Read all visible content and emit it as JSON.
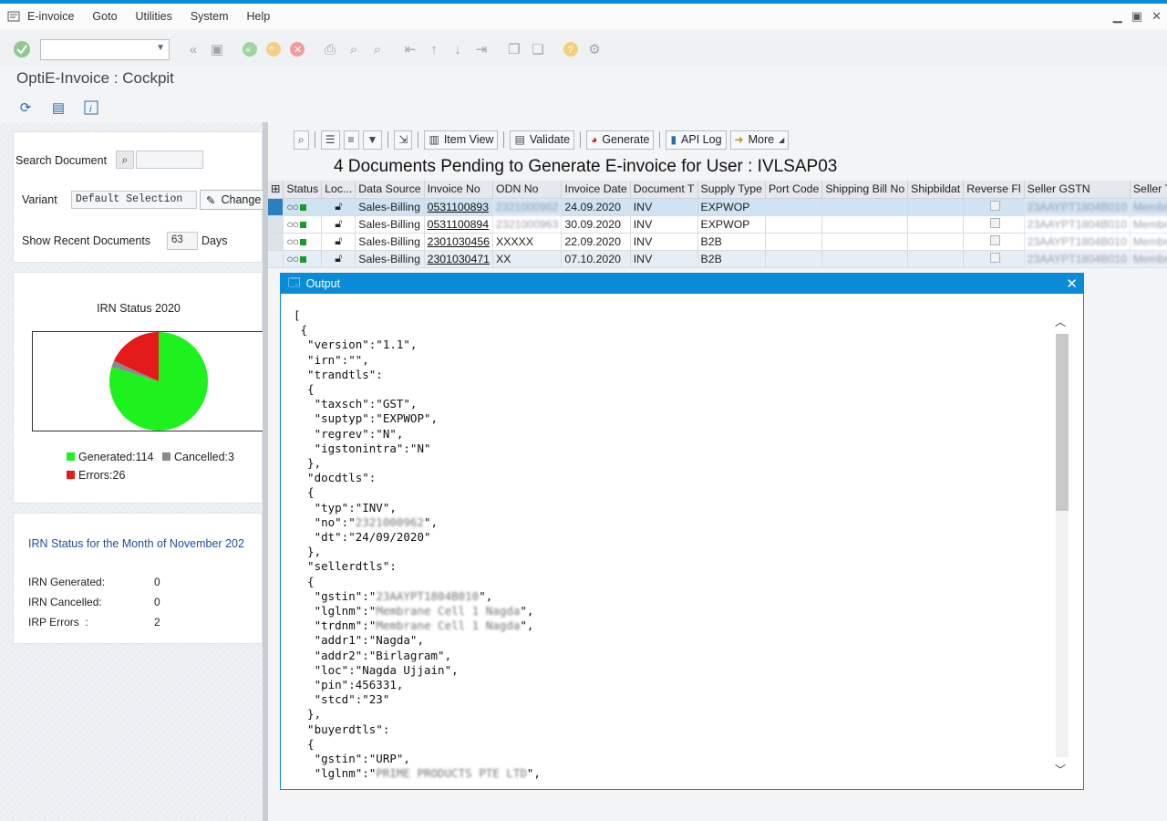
{
  "menu": [
    "E-invoice",
    "Goto",
    "Utilities",
    "System",
    "Help"
  ],
  "app_title": "OptiE-Invoice : Cockpit",
  "search": {
    "label": "Search Document",
    "variant_label": "Variant",
    "variant_value": "Default Selection",
    "change_label": "Change",
    "recent_label": "Show Recent Documents",
    "recent_value": "63",
    "recent_unit": "Days"
  },
  "pie": {
    "title": "IRN Status 2020",
    "legend": {
      "generated": "Generated:114",
      "cancelled": "Cancelled:3",
      "errors": "Errors:26"
    },
    "colors": {
      "generated": "#1ef21e",
      "cancelled": "#8a8a8a",
      "errors": "#e51a1a"
    }
  },
  "chart_data": {
    "type": "pie",
    "title": "IRN Status 2020",
    "categories": [
      "Generated",
      "Cancelled",
      "Errors"
    ],
    "values": [
      114,
      3,
      26
    ]
  },
  "month": {
    "title": "IRN Status for the Month of November 202",
    "rows": [
      {
        "k": "IRN Generated:",
        "v": "0"
      },
      {
        "k": "IRN Cancelled:",
        "v": "0"
      },
      {
        "k": "IRP Errors  :",
        "v": "2"
      }
    ]
  },
  "alv": {
    "item_view": "Item View",
    "validate": "Validate",
    "generate": "Generate",
    "api_log": "API Log",
    "more": "More"
  },
  "grid": {
    "title": "4 Documents Pending to Generate E-invoice for User : IVLSAP03",
    "headers": [
      "Status",
      "Loc...",
      "Data Source",
      "Invoice No",
      "ODN No",
      "Invoice Date",
      "Document T",
      "Supply Type",
      "Port Code",
      "Shipping Bill No",
      "Shipbildat",
      "Reverse Fl",
      "Seller GSTN",
      "Seller Trad"
    ],
    "rows": [
      {
        "src": "Sales-Billing",
        "inv": "0531100893",
        "odn": "2321000962",
        "date": "24.09.2020",
        "doc": "INV",
        "sup": "EXPWOP",
        "gstn": "23AAYPT1804B010",
        "trad": "Membrane"
      },
      {
        "src": "Sales-Billing",
        "inv": "0531100894",
        "odn": "2321000963",
        "date": "30.09.2020",
        "doc": "INV",
        "sup": "EXPWOP",
        "gstn": "23AAYPT1804B010",
        "trad": "Membrane"
      },
      {
        "src": "Sales-Billing",
        "inv": "2301030456",
        "odn": "XXXXX",
        "date": "22.09.2020",
        "doc": "INV",
        "sup": "B2B",
        "gstn": "23AAYPT1804B010",
        "trad": "Membrane"
      },
      {
        "src": "Sales-Billing",
        "inv": "2301030471",
        "odn": "XX",
        "date": "07.10.2020",
        "doc": "INV",
        "sup": "B2B",
        "gstn": "23AAYPT1804B010",
        "trad": "Membrane"
      }
    ]
  },
  "dialog": {
    "title": "Output",
    "lines": [
      "[",
      " {",
      "  \"version\":\"1.1\",",
      "  \"irn\":\"\",",
      "  \"trandtls\":",
      "  {",
      "   \"taxsch\":\"GST\",",
      "   \"suptyp\":\"EXPWOP\",",
      "   \"regrev\":\"N\",",
      "   \"igstonintra\":\"N\"",
      "  },",
      "  \"docdtls\":",
      "  {",
      "   \"typ\":\"INV\",",
      "   \"no\":\"2321000962\",",
      "   \"dt\":\"24/09/2020\"",
      "  },",
      "  \"sellerdtls\":",
      "  {",
      "   \"gstin\":\"23AAYPT1804B010\",",
      "   \"lglnm\":\"Membrane Cell 1 Nagda\",",
      "   \"trdnm\":\"Membrane Cell 1 Nagda\",",
      "   \"addr1\":\"Nagda\",",
      "   \"addr2\":\"Birlagram\",",
      "   \"loc\":\"Nagda Ujjain\",",
      "   \"pin\":456331,",
      "   \"stcd\":\"23\"",
      "  },",
      "  \"buyerdtls\":",
      "  {",
      "   \"gstin\":\"URP\",",
      "   \"lglnm\":\"PRIME PRODUCTS PTE LTD\","
    ]
  }
}
